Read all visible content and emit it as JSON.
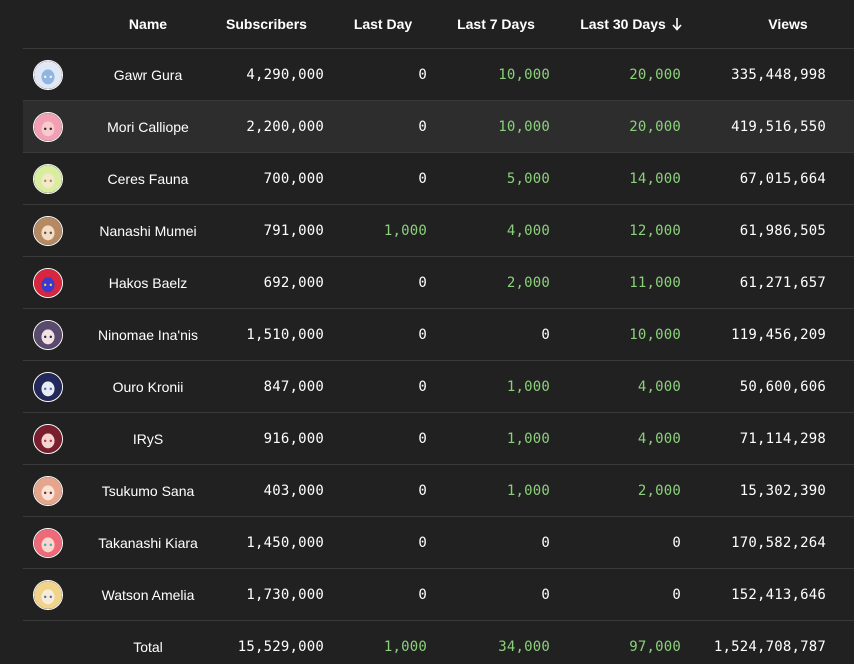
{
  "header": {
    "name": "Name",
    "subscribers": "Subscribers",
    "last_day": "Last Day",
    "last_7_days": "Last 7 Days",
    "last_30_days": "Last 30 Days",
    "views": "Views",
    "sort_icon": "arrow-down-icon"
  },
  "colors": {
    "background": "#212121",
    "row_hover": "#2d2d2d",
    "divider": "#3a3a3a",
    "positive": "#8bd17c",
    "text": "#ffffff"
  },
  "rows": [
    {
      "name": "Gawr Gura",
      "subscribers": "4,290,000",
      "last_day": "0",
      "last_7_days": "10,000",
      "last_30_days": "20,000",
      "views": "335,448,998",
      "avatar_colors": [
        "#dfe8f4",
        "#8fb5e0",
        "#f5f5f5"
      ]
    },
    {
      "name": "Mori Calliope",
      "subscribers": "2,200,000",
      "last_day": "0",
      "last_7_days": "10,000",
      "last_30_days": "20,000",
      "views": "419,516,550",
      "avatar_colors": [
        "#f29fb4",
        "#f8c9cf",
        "#2a2a2a"
      ]
    },
    {
      "name": "Ceres Fauna",
      "subscribers": "700,000",
      "last_day": "0",
      "last_7_days": "5,000",
      "last_30_days": "14,000",
      "views": "67,015,664",
      "avatar_colors": [
        "#d9eda0",
        "#f7e6c8",
        "#7aa05a"
      ]
    },
    {
      "name": "Nanashi Mumei",
      "subscribers": "791,000",
      "last_day": "1,000",
      "last_7_days": "4,000",
      "last_30_days": "12,000",
      "views": "61,986,505",
      "avatar_colors": [
        "#b58a63",
        "#f1dcc6",
        "#6b4a32"
      ]
    },
    {
      "name": "Hakos Baelz",
      "subscribers": "692,000",
      "last_day": "0",
      "last_7_days": "2,000",
      "last_30_days": "11,000",
      "views": "61,271,657",
      "avatar_colors": [
        "#d7263d",
        "#3a3ad0",
        "#f2d04a"
      ]
    },
    {
      "name": "Ninomae Ina'nis",
      "subscribers": "1,510,000",
      "last_day": "0",
      "last_7_days": "0",
      "last_30_days": "10,000",
      "views": "119,456,209",
      "avatar_colors": [
        "#5a4a6e",
        "#f2e2e6",
        "#2d2438"
      ]
    },
    {
      "name": "Ouro Kronii",
      "subscribers": "847,000",
      "last_day": "0",
      "last_7_days": "1,000",
      "last_30_days": "4,000",
      "views": "50,600,606",
      "avatar_colors": [
        "#23285a",
        "#e8ecf5",
        "#5565b8"
      ]
    },
    {
      "name": "IRyS",
      "subscribers": "916,000",
      "last_day": "0",
      "last_7_days": "1,000",
      "last_30_days": "4,000",
      "views": "71,114,298",
      "avatar_colors": [
        "#7a1e2e",
        "#f3d5cf",
        "#b8324a"
      ]
    },
    {
      "name": "Tsukumo Sana",
      "subscribers": "403,000",
      "last_day": "0",
      "last_7_days": "1,000",
      "last_30_days": "2,000",
      "views": "15,302,390",
      "avatar_colors": [
        "#e7a58e",
        "#f8e3d4",
        "#6a2d2d"
      ]
    },
    {
      "name": "Takanashi Kiara",
      "subscribers": "1,450,000",
      "last_day": "0",
      "last_7_days": "0",
      "last_30_days": "0",
      "views": "170,582,264",
      "avatar_colors": [
        "#ef6a78",
        "#f9d6d0",
        "#34b79a"
      ]
    },
    {
      "name": "Watson Amelia",
      "subscribers": "1,730,000",
      "last_day": "0",
      "last_7_days": "0",
      "last_30_days": "0",
      "views": "152,413,646",
      "avatar_colors": [
        "#f0d48c",
        "#f7ecd9",
        "#4a6ea8"
      ]
    }
  ],
  "total": {
    "label": "Total",
    "subscribers": "15,529,000",
    "last_day": "1,000",
    "last_7_days": "34,000",
    "last_30_days": "97,000",
    "views": "1,524,708,787"
  },
  "hover_row": 1
}
